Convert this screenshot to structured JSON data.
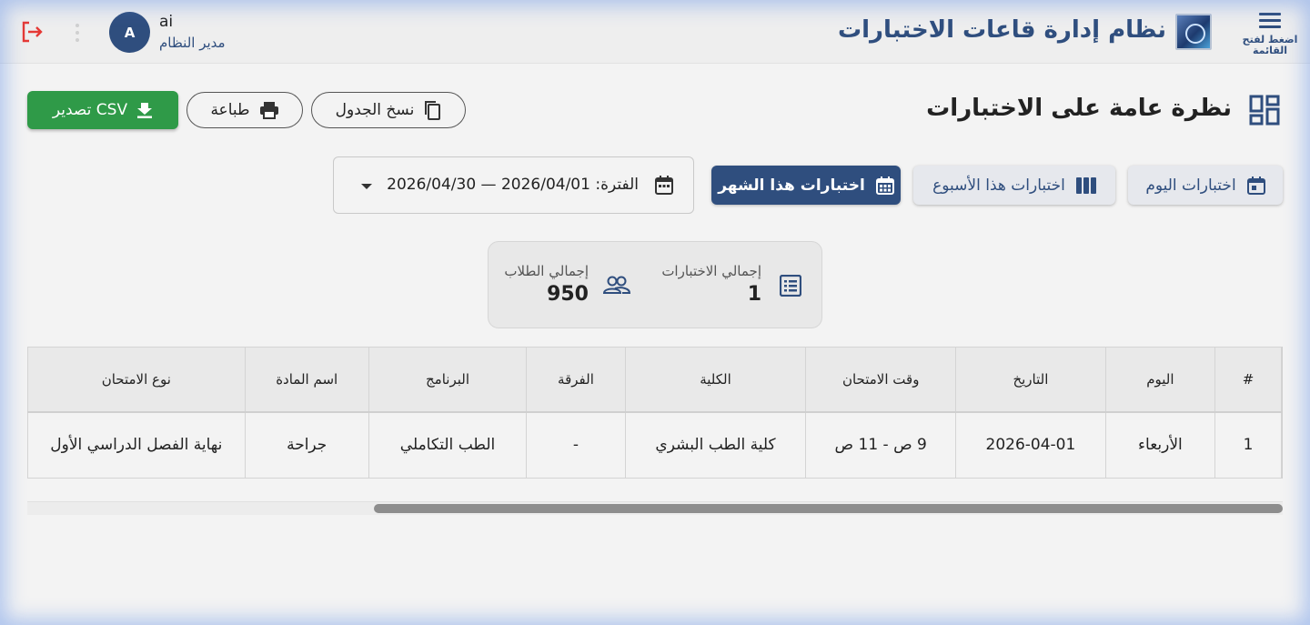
{
  "header": {
    "app_title": "نظام إدارة قاعات الاختبارات",
    "menu_label": "اضغط لفتح القائمة",
    "user": {
      "avatar_letter": "A",
      "name": "ai",
      "role": "مدير النظام"
    }
  },
  "section": {
    "title": "نظرة عامة على الاختبارات",
    "actions": {
      "csv": "تصدير CSV",
      "print": "طباعة",
      "copy": "نسخ الجدول"
    }
  },
  "filters": {
    "today": "اختبارات اليوم",
    "week": "اختبارات هذا الأسبوع",
    "month": "اختبارات هذا الشهر",
    "period_text": "الفترة: 2026/04/01 — 2026/04/30"
  },
  "stats": {
    "total_exams_label": "إجمالي الاختبارات",
    "total_exams_value": "1",
    "total_students_label": "إجمالي الطلاب",
    "total_students_value": "950"
  },
  "table": {
    "headers": [
      "#",
      "اليوم",
      "التاريخ",
      "وقت الامتحان",
      "الكلية",
      "الفرقة",
      "البرنامج",
      "اسم المادة",
      "نوع الامتحان"
    ],
    "rows": [
      [
        "1",
        "الأربعاء",
        "2026-04-01",
        "9 ص - 11 ص",
        "كلية الطب البشري",
        "-",
        "الطب التكاملي",
        "جراحة",
        "نهاية الفصل الدراسي الأول"
      ]
    ]
  },
  "colors": {
    "primary": "#2f4e7e",
    "success": "#2f9a48",
    "danger": "#e53935"
  },
  "icons": [
    "menu-icon",
    "logo",
    "logout-icon",
    "kebab-icon",
    "dashboard-icon",
    "download-icon",
    "print-icon",
    "copy-icon",
    "calendar-icon",
    "week-icon",
    "calendar-month-icon",
    "list-icon",
    "people-icon",
    "caret-down-icon"
  ]
}
